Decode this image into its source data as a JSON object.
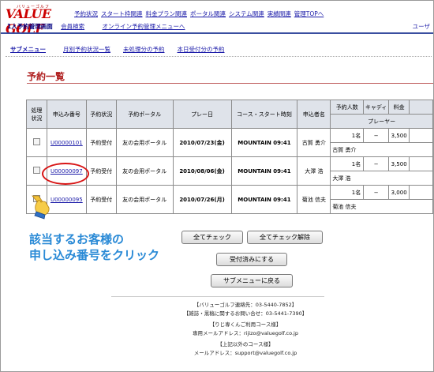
{
  "header": {
    "logo_text": "VALUE GOLF",
    "logo_sub": "バリューゴルフ",
    "nav": [
      "予約状況",
      "スタート枠関連",
      "料金プラン関連",
      "ポータル関連",
      "システム関連",
      "実績関連",
      "管理TOPへ"
    ],
    "screen_title": "1人予約管理画面",
    "member_search": "会員検索",
    "online_link": "オンライン予約管理メニューへ",
    "user_link": "ユーザ"
  },
  "submenu": {
    "items": [
      "サブメニュー",
      "月別予約状況一覧",
      "未処理分の予約",
      "本日受付分の予約"
    ]
  },
  "page": {
    "title": "予約一覧"
  },
  "table": {
    "headers": {
      "status": "処理\n状況",
      "number": "申込み番号",
      "res_status": "予約状況",
      "portal": "予約ポータル",
      "play_date": "プレー日",
      "course_time": "コース・スタート時刻",
      "applicant": "申込者名",
      "people": "予約人数",
      "caddie": "キャディ",
      "fee": "料金",
      "player": "プレーヤー"
    },
    "rows": [
      {
        "number": "U00000101",
        "status": "予約受付",
        "portal": "友の会用ポータル",
        "date": "2010/07/23(金)",
        "course": "MOUNTAIN 09:41",
        "applicant": "古賀 勇介",
        "people": "1名",
        "caddie": "−",
        "fee": "3,500",
        "player": "古賀 勇介"
      },
      {
        "number": "U00000097",
        "status": "予約受付",
        "portal": "友の会用ポータル",
        "date": "2010/08/06(金)",
        "course": "MOUNTAIN 09:41",
        "applicant": "大澤 浩",
        "people": "1名",
        "caddie": "−",
        "fee": "3,500",
        "player": "大澤 浩"
      },
      {
        "number": "U00000095",
        "status": "予約受付",
        "portal": "友の会用ポータル",
        "date": "2010/07/26(月)",
        "course": "MOUNTAIN 09:41",
        "applicant": "菊池 信夫",
        "people": "1名",
        "caddie": "−",
        "fee": "3,000",
        "player": "菊池 信夫"
      }
    ]
  },
  "instruction": {
    "line1": "該当するお客様の",
    "line2": "申し込み番号をクリック"
  },
  "buttons": {
    "check_all": "全てチェック",
    "uncheck_all": "全てチェック解除",
    "accept": "受付済みにする",
    "back": "サブメニューに戻る"
  },
  "footer": {
    "line1": "【バリューゴルフ連絡先：03-5440-7852】",
    "line2": "【雑誌・黒稿に関するお問い合せ：03-5441-7390】",
    "line3": "【りじ専くんご利用コース様】",
    "line4": "専用メールアドレス：rijizo@valuegolf.co.jp",
    "line5": "【上記以外のコース様】",
    "line6": "メールアドレス：support@valuegolf.co.jp"
  },
  "colors": {
    "brand_red": "#cc0000",
    "link_blue": "#1a1aa8",
    "instruction_blue": "#2a8ad6",
    "highlight_red": "#d81515",
    "header_bg": "#dfe3ea"
  }
}
